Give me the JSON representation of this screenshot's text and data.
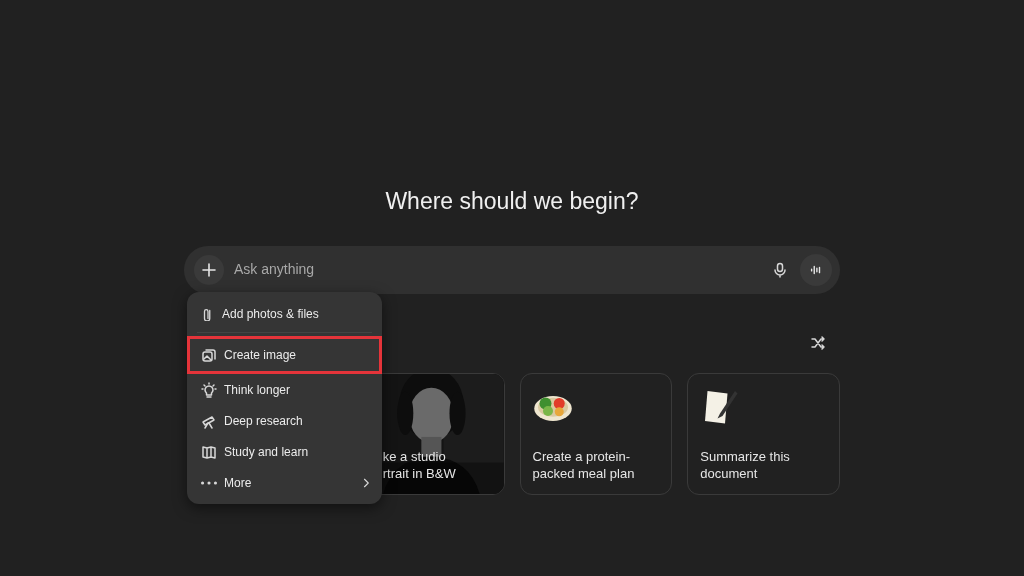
{
  "heading": "Where should we begin?",
  "composer": {
    "placeholder": "Ask anything"
  },
  "attach_menu": {
    "items": [
      {
        "kind": "attach",
        "label": "Add photos & files",
        "highlighted": false,
        "divider_after": true
      },
      {
        "label": "Create image",
        "highlighted": true,
        "divider_after": false
      },
      {
        "kind": "think",
        "label": "Think longer",
        "highlighted": false,
        "divider_after": false
      },
      {
        "kind": "research",
        "label": "Deep research",
        "highlighted": false,
        "divider_after": false
      },
      {
        "kind": "study",
        "label": "Study and learn",
        "highlighted": false,
        "divider_after": false
      },
      {
        "kind": "more",
        "label": "More",
        "highlighted": false,
        "divider_after": false
      }
    ]
  },
  "suggestions": [
    {
      "kind": "hidden"
    },
    {
      "text": "ke a studio\nrtrait in B&W"
    },
    {
      "kind": "meal",
      "text": "Create a protein-\npacked meal plan"
    },
    {
      "kind": "document",
      "text": "Summarize this\ndocument"
    }
  ]
}
